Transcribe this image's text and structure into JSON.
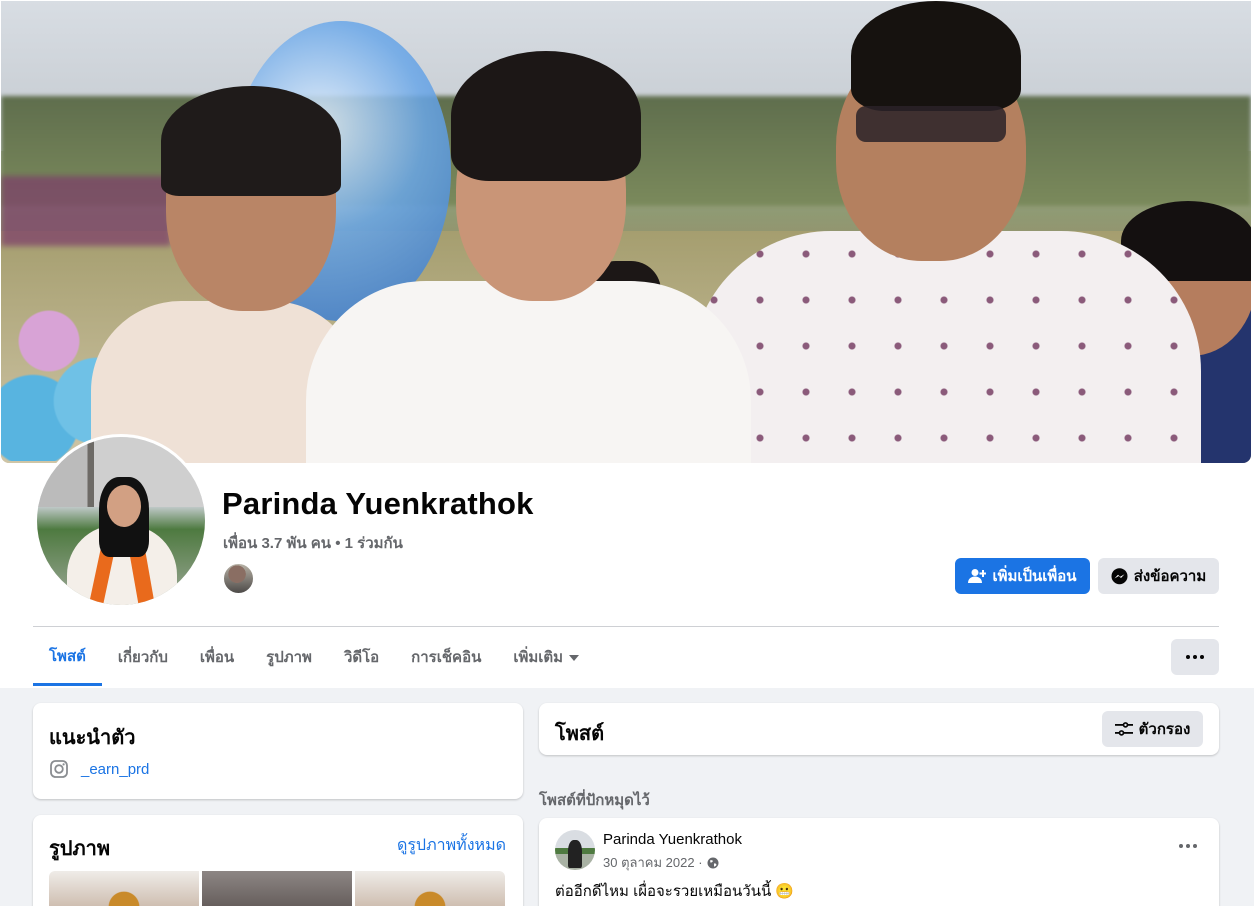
{
  "profile": {
    "name": "Parinda Yuenkrathok",
    "friends_line": "เพื่อน 3.7 พัน คน • 1 ร่วมกัน"
  },
  "actions": {
    "add_friend": "เพิ่มเป็นเพื่อน",
    "message": "ส่งข้อความ"
  },
  "tabs": [
    {
      "label": "โพสต์",
      "active": true
    },
    {
      "label": "เกี่ยวกับ",
      "active": false
    },
    {
      "label": "เพื่อน",
      "active": false
    },
    {
      "label": "รูปภาพ",
      "active": false
    },
    {
      "label": "วิดีโอ",
      "active": false
    },
    {
      "label": "การเช็คอิน",
      "active": false
    },
    {
      "label": "เพิ่มเติม",
      "active": false
    }
  ],
  "intro": {
    "title": "แนะนำตัว",
    "instagram": "_earn_prd"
  },
  "photos": {
    "title": "รูปภาพ",
    "see_all": "ดูรูปภาพทั้งหมด"
  },
  "posts": {
    "title": "โพสต์",
    "filter": "ตัวกรอง",
    "pinned_label": "โพสต์ที่ปักหมุดไว้"
  },
  "post": {
    "author": "Parinda Yuenkrathok",
    "date": "30 ตุลาคม 2022 ·",
    "text": "ต่ออีกดีไหม เผื่อจะรวยเหมือนวันนี้ 😬"
  },
  "colors": {
    "primary": "#1b74e4",
    "background": "#f0f2f5",
    "secondary_button": "#e4e6eb"
  }
}
